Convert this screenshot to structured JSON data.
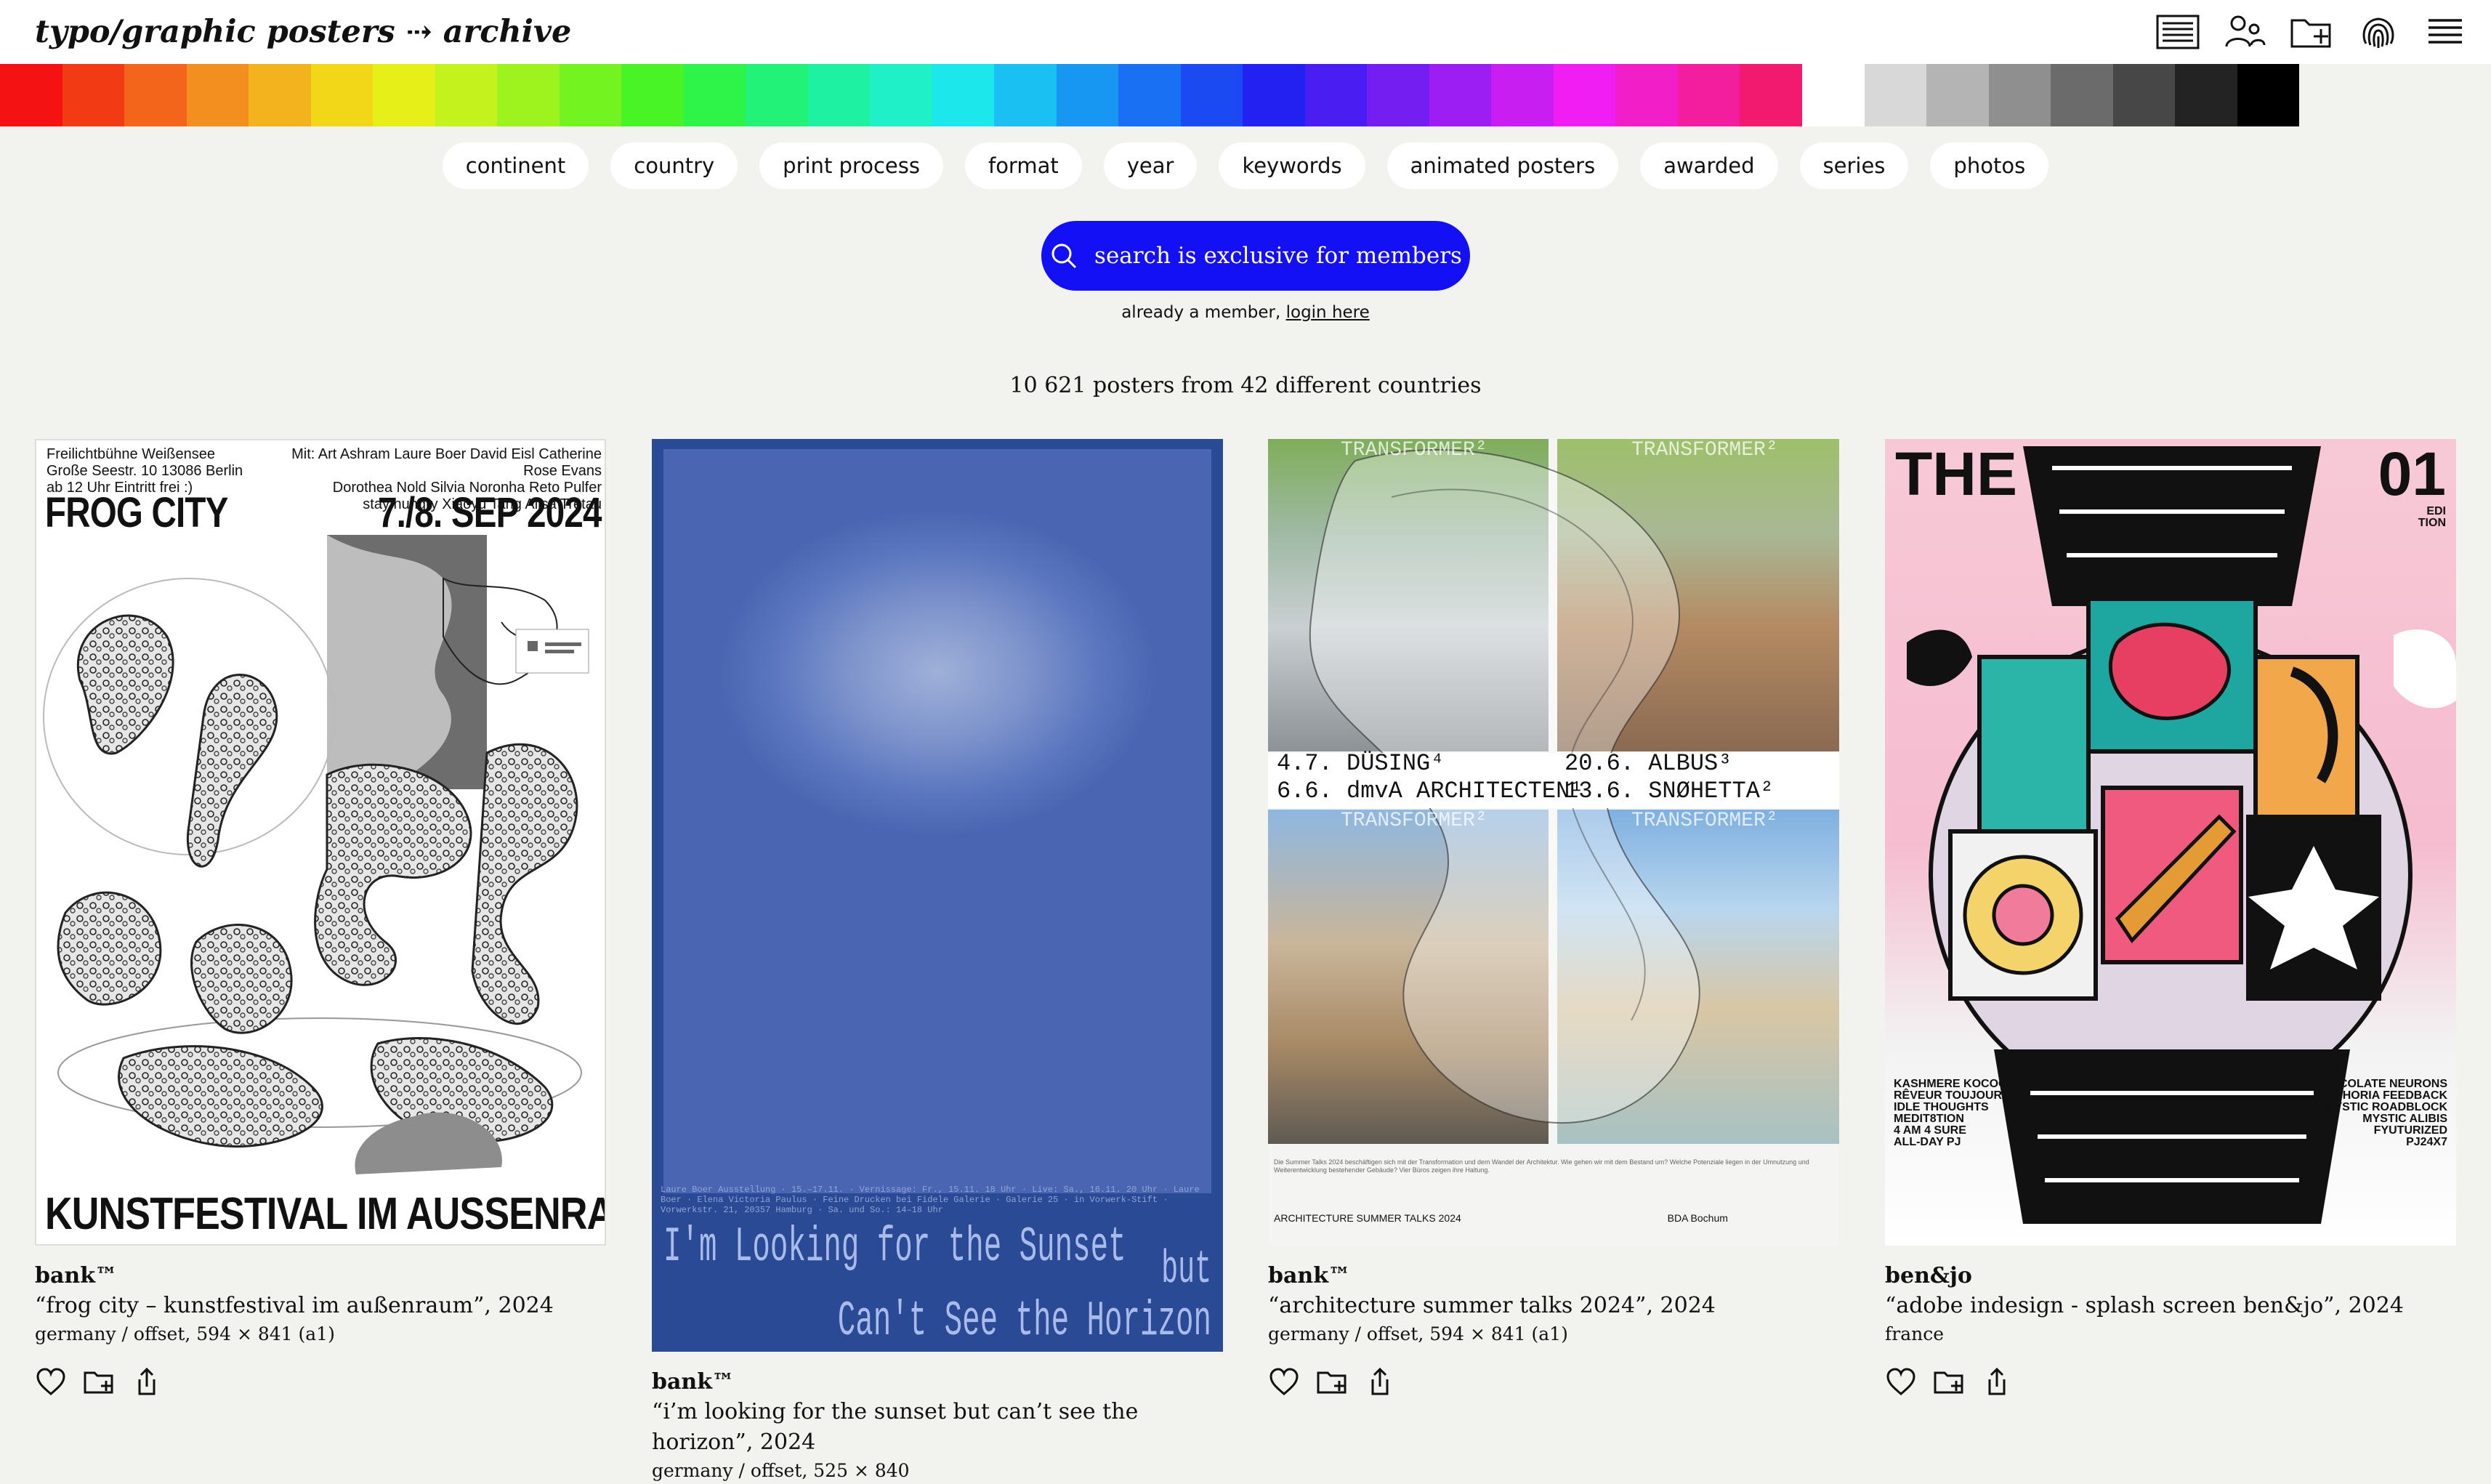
{
  "header": {
    "logo": "typo/graphic posters ⤏ archive",
    "icons": [
      "list-view-icon",
      "members-icon",
      "add-folder-icon",
      "fingerprint-icon",
      "menu-icon"
    ]
  },
  "palette": {
    "colors": [
      "#f41212",
      "#f23a15",
      "#f2651a",
      "#f28f1e",
      "#f2b31e",
      "#f1d718",
      "#e6ef18",
      "#c4f21c",
      "#9ef31e",
      "#73f420",
      "#49f426",
      "#2ef449",
      "#22f277",
      "#1ef2a2",
      "#1ff0c8",
      "#1ce8ec",
      "#1ac0f2",
      "#1897f2",
      "#1a70f2",
      "#1b4af2",
      "#2221f2",
      "#4a1ef2",
      "#741ef2",
      "#9d1ef2",
      "#c81ef2",
      "#f01ef2",
      "#f21ec8",
      "#f21e9e",
      "#f21a6e",
      "#ffffff",
      "#d8d8d8",
      "#b4b4b4",
      "#8f8f8f",
      "#6b6b6b",
      "#474747",
      "#232323",
      "#000000"
    ]
  },
  "filters": [
    "continent",
    "country",
    "print process",
    "format",
    "year",
    "keywords",
    "animated posters",
    "awarded",
    "series",
    "photos"
  ],
  "search": {
    "button_label": "search is exclusive for members",
    "member_prefix": "already a member, ",
    "member_link": "login here"
  },
  "summary": "10 621 posters from 42 different countries",
  "cards": [
    {
      "studio": "bank™",
      "title": "“frog city – kunstfestival im außenraum”, 2024",
      "meta": "germany / offset, 594 × 841 (a1)",
      "poster": {
        "info_col1": [
          "Freilichtbühne Weißensee",
          "Große Seestr. 10   13086 Berlin",
          "ab 12 Uhr    Eintritt frei :)"
        ],
        "info_col2": [
          "Mit:  Art Ashram    Laure Boer    David Eisl    Catherine Rose Evans",
          "Dorothea Nold    Silvia Noronha    Reto Pulfer",
          "stay  hungry    Xiaoyu Tang    Alisa Tretau"
        ],
        "headline_left": "FROG CITY",
        "headline_right": "7./8. SEP 2024",
        "footer": "KUNSTFESTIVAL IM AUSSENRAUM"
      }
    },
    {
      "studio": "bank™",
      "title": "“i’m looking for the sunset but can’t see the horizon”, 2024",
      "meta": "germany / offset, 525 × 840",
      "poster": {
        "small_print": "Laure Boer Ausstellung · 15.–17.11. · Vernissage: Fr., 15.11. 18 Uhr · Live: Sa., 16.11. 20 Uhr · Laure Boer · Elena Victoria Paulus · Feine Drucken bei Fidele Galerie · Galerie 25 · in Vorwerk-Stift · Vorwerkstr. 21, 20357 Hamburg · Sa. und So.: 14–18 Uhr",
        "line1": "I'm Looking for the Sunset",
        "line2": "but",
        "line3": "Can't See the Horizon"
      }
    },
    {
      "studio": "bank™",
      "title": "“architecture summer talks 2024”, 2024",
      "meta": "germany / offset, 594 × 841 (a1)",
      "poster": {
        "watermark": "TRANSFORMER²",
        "left_1": "4.7. DÜSING⁴",
        "left_2": "6.6. dmvA ARCHITECTEN¹",
        "right_1": "20.6. ALBUS³",
        "right_2": "13.6. SNØHETTA²",
        "small_print": "Die Summer Talks 2024 beschäftigen sich mit der Transformation und dem Wandel der Architektur. Wie gehen wir mit dem Bestand um? Welche Potenziale liegen in der Umnutzung und Weiterentwicklung bestehender Gebäude? Vier Büros zeigen ihre Haltung.",
        "bottom_1": "ARCHITECTURE SUMMER TALKS 2024",
        "bottom_2": "BDA  Bochum"
      }
    },
    {
      "studio": "ben&jo",
      "title": "“adobe indesign - splash screen ben&jo”, 2024",
      "meta": "france",
      "poster": {
        "the": "THE",
        "number": "01",
        "edition": [
          "EDI",
          "TION"
        ],
        "list_left": [
          "KASHMERE KOCOON",
          "RÊVEUR TOUJOURS",
          "IDLE THOUGHTS",
          "MEDIT8TION",
          "4 AM 4 SURE",
          "ALL-DAY PJ"
        ],
        "list_right": [
          "CHOCOLATE NEURONS",
          "EUPHORIA FEEDBACK",
          "MYSTIC ROADBLOCK",
          "MYSTIC ALIBIS",
          "FYUTURIZED",
          "PJ24X7"
        ]
      }
    }
  ]
}
